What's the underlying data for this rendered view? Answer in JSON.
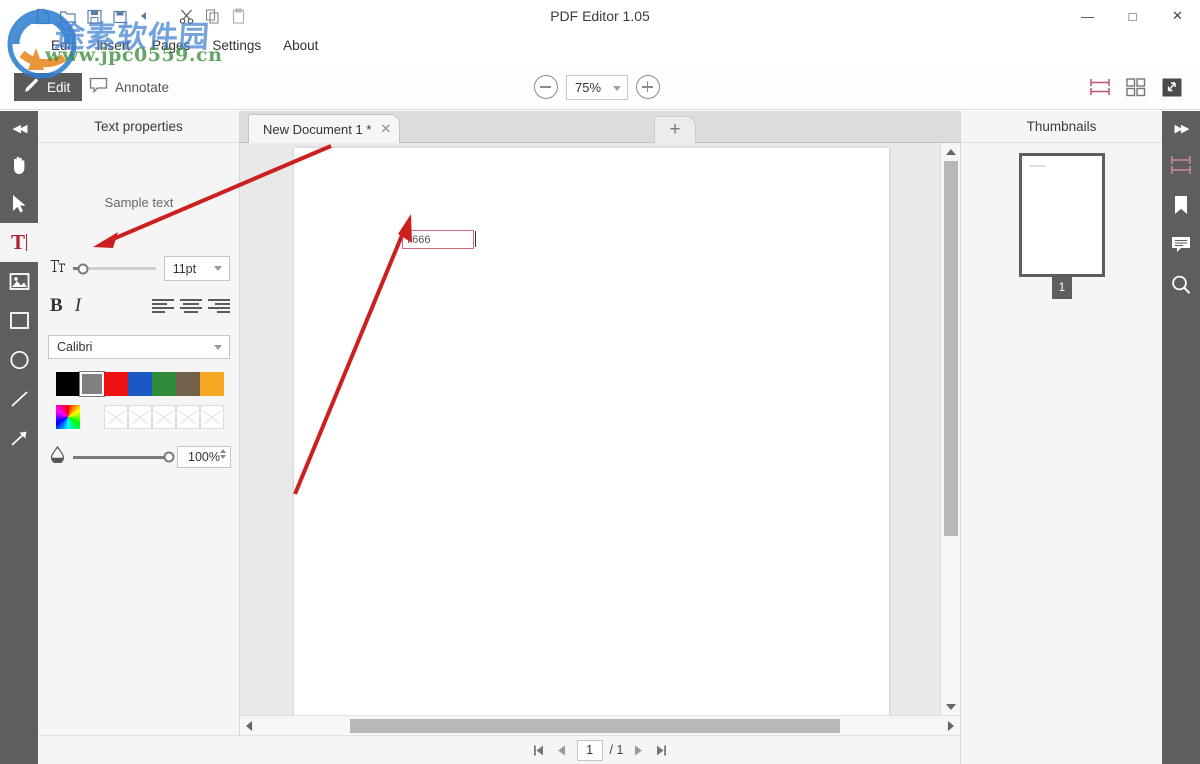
{
  "window": {
    "title": "PDF Editor 1.05",
    "minimize": "—",
    "maximize": "□",
    "close": "✕"
  },
  "watermark": {
    "cn_text": "途素软件园",
    "url": "www.jpc0559.cn"
  },
  "toolbar_icons": [
    {
      "name": "new-document-icon"
    },
    {
      "name": "open-folder-icon"
    },
    {
      "name": "save-icon"
    },
    {
      "name": "save-as-icon"
    },
    {
      "name": "undo-icon"
    },
    {
      "name": "cut-icon"
    },
    {
      "name": "copy-icon"
    },
    {
      "name": "paste-icon"
    }
  ],
  "menu": {
    "items": [
      {
        "label": "Edit"
      },
      {
        "label": "Insert"
      },
      {
        "label": "Pages"
      },
      {
        "label": "Settings"
      },
      {
        "label": "About"
      }
    ]
  },
  "modebar": {
    "edit_label": "Edit",
    "annotate_label": "Annotate",
    "zoom_value": "75%",
    "zoom_out_title": "Zoom out",
    "zoom_in_title": "Zoom in"
  },
  "tools": {
    "collapse_label": "◀◀",
    "items": [
      {
        "name": "hand-tool",
        "label": "Hand"
      },
      {
        "name": "select-tool",
        "label": "Select"
      },
      {
        "name": "text-tool",
        "label": "T"
      },
      {
        "name": "image-tool",
        "label": "Image"
      },
      {
        "name": "rectangle-tool",
        "label": "Rectangle"
      },
      {
        "name": "ellipse-tool",
        "label": "Ellipse"
      },
      {
        "name": "line-tool",
        "label": "Line"
      },
      {
        "name": "arrow-tool",
        "label": "Arrow"
      }
    ]
  },
  "properties": {
    "header": "Text properties",
    "sample_text": "Sample text",
    "font_size": "11pt",
    "font_size_slider_percent": 12,
    "bold_label": "B",
    "italic_label": "I",
    "font_family": "Calibri",
    "opacity": "100%",
    "opacity_slider_percent": 100,
    "colors": [
      {
        "name": "black",
        "hex": "#000000",
        "selected": false
      },
      {
        "name": "gray",
        "hex": "#808080",
        "selected": true
      },
      {
        "name": "red",
        "hex": "#ee1111",
        "selected": false
      },
      {
        "name": "blue",
        "hex": "#1a56c4",
        "selected": false
      },
      {
        "name": "green",
        "hex": "#2e8b3a",
        "selected": false
      },
      {
        "name": "brown",
        "hex": "#73604a",
        "selected": false
      },
      {
        "name": "orange",
        "hex": "#f5a623",
        "selected": false
      }
    ],
    "empty_slots": 5
  },
  "tabs": {
    "items": [
      {
        "label": "New Document 1 *",
        "close": "✕"
      }
    ],
    "add_label": "+"
  },
  "document": {
    "textbox_value": "7666"
  },
  "thumbnails": {
    "header": "Thumbnails",
    "pages": [
      {
        "number": "1"
      }
    ]
  },
  "right_rail": {
    "expand_label": "▶▶",
    "items": [
      {
        "name": "page-layout-icon"
      },
      {
        "name": "bookmark-icon"
      },
      {
        "name": "comment-icon"
      },
      {
        "name": "search-icon"
      }
    ]
  },
  "page_nav": {
    "current_page": "1",
    "total": "/ 1"
  },
  "layout_buttons": [
    {
      "name": "single-page-layout-icon"
    },
    {
      "name": "grid-layout-icon"
    },
    {
      "name": "fullscreen-icon"
    }
  ],
  "accent": {
    "rail_bg": "#5e5e5e",
    "active_tool": "#b02030",
    "textbox_border": "#d06b78",
    "annotation_arrow": "#cc2020"
  }
}
